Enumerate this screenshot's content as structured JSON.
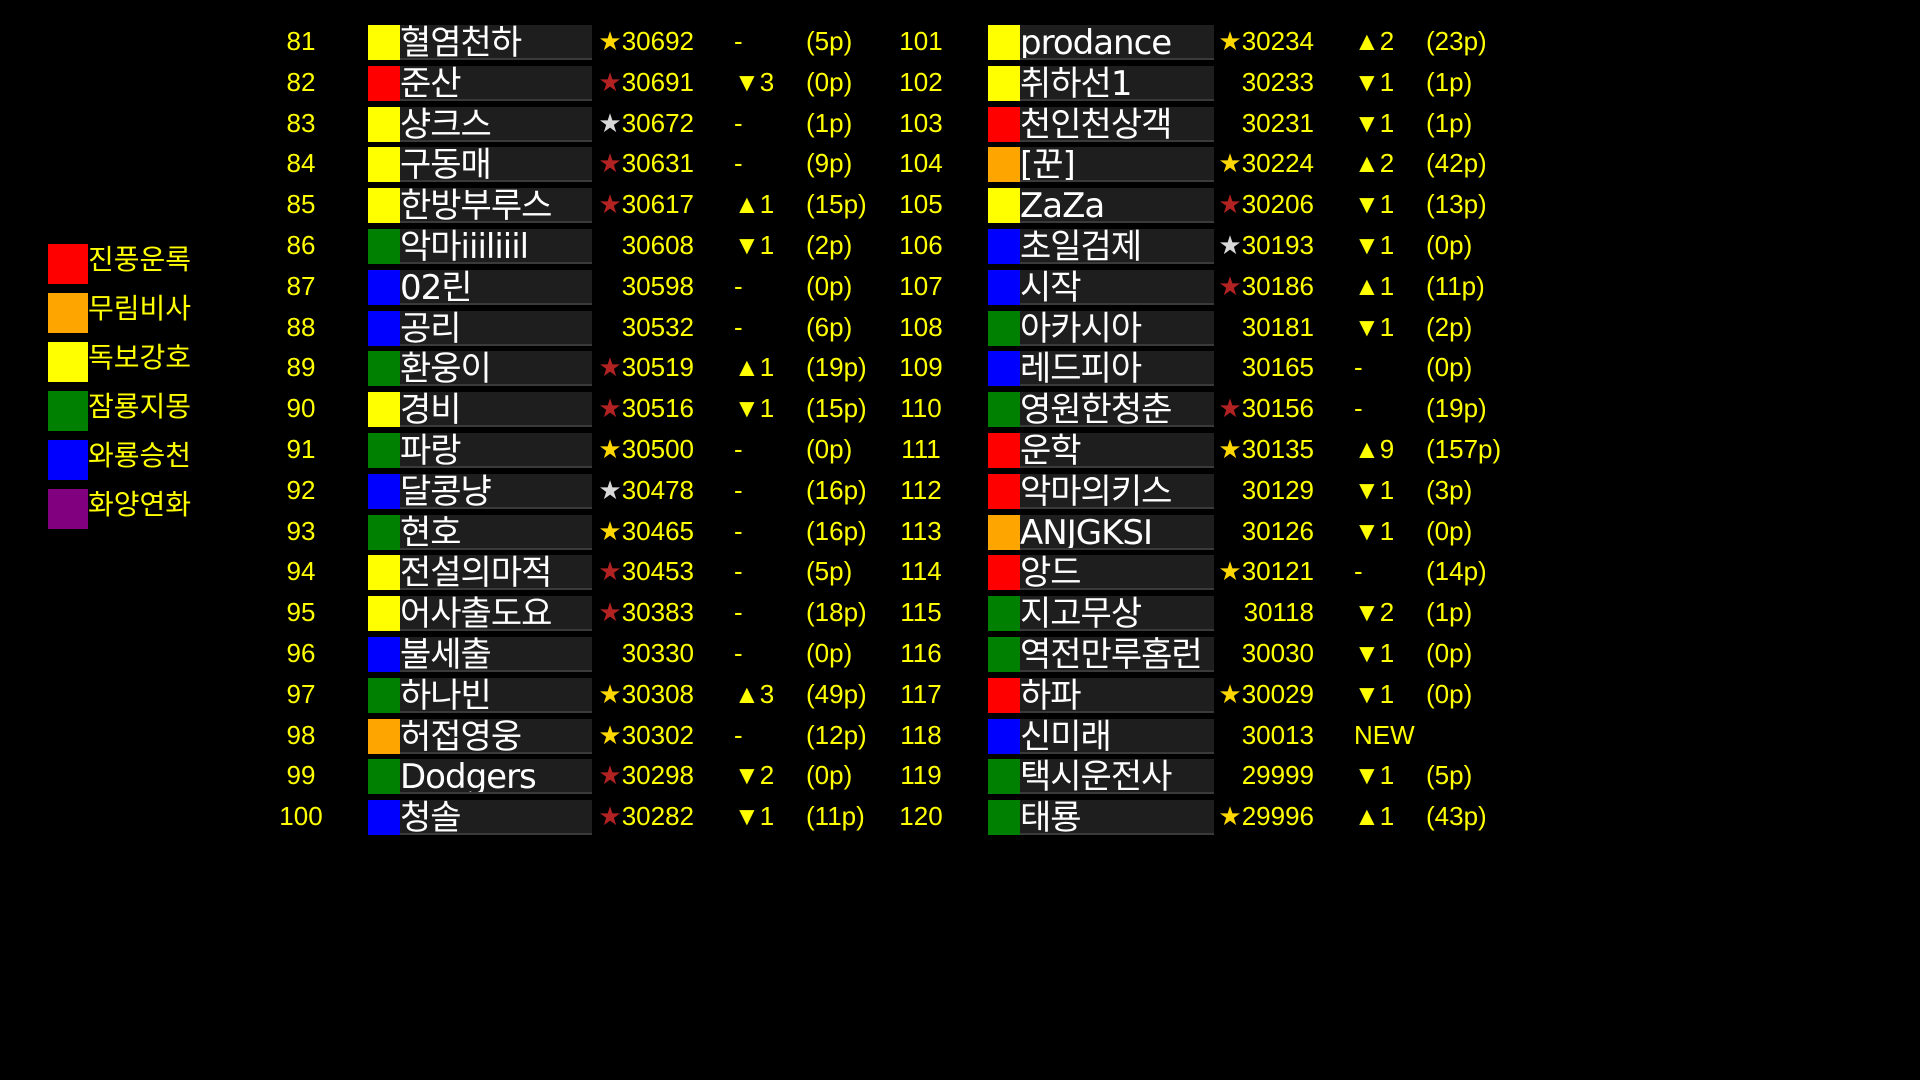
{
  "colors": {
    "red": "#ff0000",
    "orange": "#ffa500",
    "yellow": "#ffff00",
    "green": "#008000",
    "blue": "#0000ff",
    "purple": "#800080"
  },
  "legend": [
    {
      "label": "진풍운록",
      "color": "#ff0000"
    },
    {
      "label": "무림비사",
      "color": "#ffa500"
    },
    {
      "label": "독보강호",
      "color": "#ffff00"
    },
    {
      "label": "잠룡지몽",
      "color": "#008000"
    },
    {
      "label": "와룡승천",
      "color": "#0000ff"
    },
    {
      "label": "화양연화",
      "color": "#800080"
    }
  ],
  "left_rows": [
    {
      "rank": "81",
      "color": "yellow",
      "name": "혈염천하",
      "star": "gold",
      "score": "30692",
      "change": "-",
      "points": "(5p)"
    },
    {
      "rank": "82",
      "color": "red",
      "name": "준산",
      "star": "red",
      "score": "30691",
      "change": "▼3",
      "points": "(0p)"
    },
    {
      "rank": "83",
      "color": "yellow",
      "name": "샹크스",
      "star": "silver",
      "score": "30672",
      "change": "-",
      "points": "(1p)"
    },
    {
      "rank": "84",
      "color": "yellow",
      "name": "구동매",
      "star": "red",
      "score": "30631",
      "change": "-",
      "points": "(9p)"
    },
    {
      "rank": "85",
      "color": "yellow",
      "name": "한방부루스",
      "star": "red",
      "score": "30617",
      "change": "▲1",
      "points": "(15p)"
    },
    {
      "rank": "86",
      "color": "green",
      "name": "악마iiiliiil",
      "star": "",
      "score": "30608",
      "change": "▼1",
      "points": "(2p)"
    },
    {
      "rank": "87",
      "color": "blue",
      "name": "02린",
      "star": "",
      "score": "30598",
      "change": "-",
      "points": "(0p)"
    },
    {
      "rank": "88",
      "color": "blue",
      "name": "공리",
      "star": "",
      "score": "30532",
      "change": "-",
      "points": "(6p)"
    },
    {
      "rank": "89",
      "color": "green",
      "name": "환웅이",
      "star": "red",
      "score": "30519",
      "change": "▲1",
      "points": "(19p)"
    },
    {
      "rank": "90",
      "color": "yellow",
      "name": "경비",
      "star": "red",
      "score": "30516",
      "change": "▼1",
      "points": "(15p)"
    },
    {
      "rank": "91",
      "color": "green",
      "name": "파랑",
      "star": "gold",
      "score": "30500",
      "change": "-",
      "points": "(0p)"
    },
    {
      "rank": "92",
      "color": "blue",
      "name": "달콩냥",
      "star": "silver",
      "score": "30478",
      "change": "-",
      "points": "(16p)"
    },
    {
      "rank": "93",
      "color": "green",
      "name": "현호",
      "star": "gold",
      "score": "30465",
      "change": "-",
      "points": "(16p)"
    },
    {
      "rank": "94",
      "color": "yellow",
      "name": "전설의마적",
      "star": "red",
      "score": "30453",
      "change": "-",
      "points": "(5p)"
    },
    {
      "rank": "95",
      "color": "yellow",
      "name": "어사출도요",
      "star": "red",
      "score": "30383",
      "change": "-",
      "points": "(18p)"
    },
    {
      "rank": "96",
      "color": "blue",
      "name": "불세출",
      "star": "",
      "score": "30330",
      "change": "-",
      "points": "(0p)"
    },
    {
      "rank": "97",
      "color": "green",
      "name": "하나빈",
      "star": "gold",
      "score": "30308",
      "change": "▲3",
      "points": "(49p)"
    },
    {
      "rank": "98",
      "color": "orange",
      "name": "허접영웅",
      "star": "gold",
      "score": "30302",
      "change": "-",
      "points": "(12p)"
    },
    {
      "rank": "99",
      "color": "green",
      "name": "Dodgers",
      "star": "red",
      "score": "30298",
      "change": "▼2",
      "points": "(0p)"
    },
    {
      "rank": "100",
      "color": "blue",
      "name": "청솔",
      "star": "red",
      "score": "30282",
      "change": "▼1",
      "points": "(11p)"
    }
  ],
  "right_rows": [
    {
      "rank": "101",
      "color": "yellow",
      "name": "prodance",
      "star": "gold",
      "score": "30234",
      "change": "▲2",
      "points": "(23p)"
    },
    {
      "rank": "102",
      "color": "yellow",
      "name": "취하선1",
      "star": "",
      "score": "30233",
      "change": "▼1",
      "points": "(1p)"
    },
    {
      "rank": "103",
      "color": "red",
      "name": "천인천상객",
      "star": "",
      "score": "30231",
      "change": "▼1",
      "points": "(1p)"
    },
    {
      "rank": "104",
      "color": "orange",
      "name": "[꾼]",
      "star": "gold",
      "score": "30224",
      "change": "▲2",
      "points": "(42p)"
    },
    {
      "rank": "105",
      "color": "yellow",
      "name": "ZaZa",
      "star": "red",
      "score": "30206",
      "change": "▼1",
      "points": "(13p)"
    },
    {
      "rank": "106",
      "color": "blue",
      "name": "초일검제",
      "star": "silver",
      "score": "30193",
      "change": "▼1",
      "points": "(0p)"
    },
    {
      "rank": "107",
      "color": "blue",
      "name": "시작",
      "star": "red",
      "score": "30186",
      "change": "▲1",
      "points": "(11p)"
    },
    {
      "rank": "108",
      "color": "green",
      "name": "아카시아",
      "star": "",
      "score": "30181",
      "change": "▼1",
      "points": "(2p)"
    },
    {
      "rank": "109",
      "color": "blue",
      "name": "레드피아",
      "star": "",
      "score": "30165",
      "change": "-",
      "points": "(0p)"
    },
    {
      "rank": "110",
      "color": "green",
      "name": "영원한청춘",
      "star": "red",
      "score": "30156",
      "change": "-",
      "points": "(19p)"
    },
    {
      "rank": "111",
      "color": "red",
      "name": "운학",
      "star": "gold",
      "score": "30135",
      "change": "▲9",
      "points": "(157p)"
    },
    {
      "rank": "112",
      "color": "red",
      "name": "악마의키스",
      "star": "",
      "score": "30129",
      "change": "▼1",
      "points": "(3p)"
    },
    {
      "rank": "113",
      "color": "orange",
      "name": "ANJGKSI",
      "star": "",
      "score": "30126",
      "change": "▼1",
      "points": "(0p)"
    },
    {
      "rank": "114",
      "color": "red",
      "name": "앙드",
      "star": "gold",
      "score": "30121",
      "change": "-",
      "points": "(14p)"
    },
    {
      "rank": "115",
      "color": "green",
      "name": "지고무상",
      "star": "",
      "score": "30118",
      "change": "▼2",
      "points": "(1p)"
    },
    {
      "rank": "116",
      "color": "green",
      "name": "역전만루홈런",
      "star": "",
      "score": "30030",
      "change": "▼1",
      "points": "(0p)"
    },
    {
      "rank": "117",
      "color": "red",
      "name": "하파",
      "star": "gold",
      "score": "30029",
      "change": "▼1",
      "points": "(0p)"
    },
    {
      "rank": "118",
      "color": "blue",
      "name": "신미래",
      "star": "",
      "score": "30013",
      "change": "NEW",
      "points": ""
    },
    {
      "rank": "119",
      "color": "green",
      "name": "택시운전사",
      "star": "",
      "score": "29999",
      "change": "▼1",
      "points": "(5p)"
    },
    {
      "rank": "120",
      "color": "green",
      "name": "태룡",
      "star": "gold",
      "score": "29996",
      "change": "▲1",
      "points": "(43p)"
    }
  ]
}
